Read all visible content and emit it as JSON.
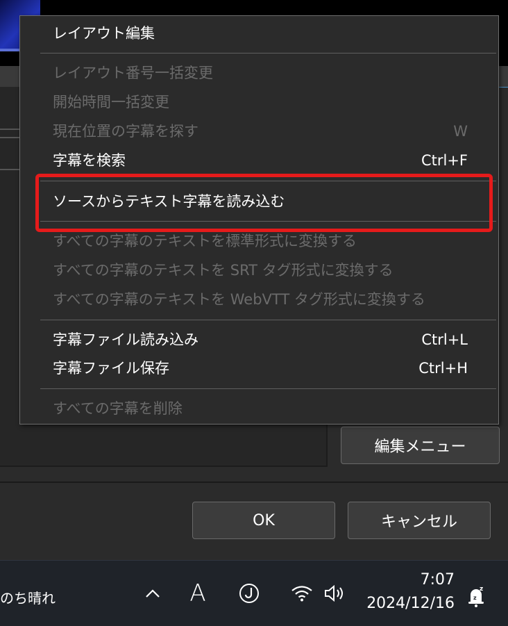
{
  "menu": {
    "items": [
      {
        "label": "レイアウト編集",
        "shortcut": "",
        "enabled": true
      },
      {
        "label": "レイアウト番号一括変更",
        "shortcut": "",
        "enabled": false
      },
      {
        "label": "開始時間一括変更",
        "shortcut": "",
        "enabled": false
      },
      {
        "label": "現在位置の字幕を探す",
        "shortcut": "W",
        "enabled": false
      },
      {
        "label": "字幕を検索",
        "shortcut": "Ctrl+F",
        "enabled": true
      },
      {
        "label": "ソースからテキスト字幕を読み込む",
        "shortcut": "",
        "enabled": true
      },
      {
        "label": "すべての字幕のテキストを標準形式に変換する",
        "shortcut": "",
        "enabled": false
      },
      {
        "label": "すべての字幕のテキストを SRT タグ形式に変換する",
        "shortcut": "",
        "enabled": false
      },
      {
        "label": "すべての字幕のテキストを WebVTT タグ形式に変換する",
        "shortcut": "",
        "enabled": false
      },
      {
        "label": "字幕ファイル読み込み",
        "shortcut": "Ctrl+L",
        "enabled": true
      },
      {
        "label": "字幕ファイル保存",
        "shortcut": "Ctrl+H",
        "enabled": true
      },
      {
        "label": "すべての字幕を削除",
        "shortcut": "",
        "enabled": false
      }
    ],
    "highlight_color": "#e51b1b"
  },
  "dialog": {
    "edit_menu_label": "編集メニュー",
    "ok_label": "OK",
    "cancel_label": "キャンセル"
  },
  "taskbar": {
    "weather_text": "のち晴れ",
    "ime_mode": "A",
    "time": "7:07",
    "date": "2024/12/16",
    "icons": [
      "chevron-up-icon",
      "ime-icon",
      "wifi-icon",
      "volume-icon",
      "notification-sleep-icon"
    ]
  }
}
